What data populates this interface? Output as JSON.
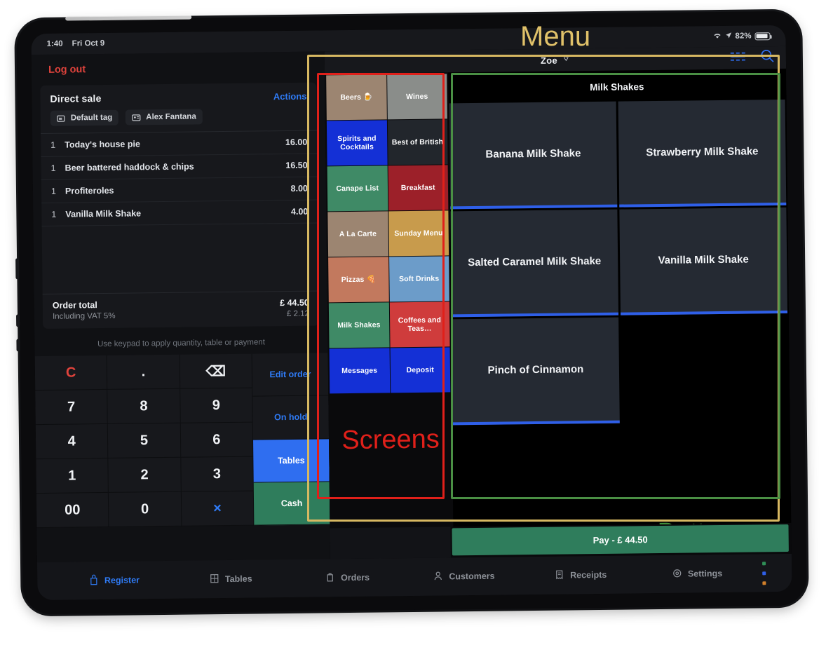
{
  "status_bar": {
    "time": "1:40",
    "date": "Fri Oct 9",
    "battery_pct": "82%",
    "wifi_icon": "wifi-icon",
    "location_icon": "location-arrow-icon"
  },
  "left_pane": {
    "logout_label": "Log out",
    "sale_title": "Direct sale",
    "actions_label": "Actions",
    "chips": [
      {
        "label": "Default tag",
        "icon": "tag-icon"
      },
      {
        "label": "Alex Fantana",
        "icon": "contact-card-icon"
      }
    ],
    "line_items": [
      {
        "qty": "1",
        "name": "Today's house pie",
        "price": "16.00"
      },
      {
        "qty": "1",
        "name": "Beer battered haddock & chips",
        "price": "16.50"
      },
      {
        "qty": "1",
        "name": "Profiteroles",
        "price": "8.00"
      },
      {
        "qty": "1",
        "name": "Vanilla Milk Shake",
        "price": "4.00"
      }
    ],
    "totals": {
      "order_total_label": "Order total",
      "order_total_value": "£ 44.50",
      "vat_label": "Including VAT 5%",
      "vat_value": "£ 2.12"
    },
    "keypad_hint": "Use keypad to apply quantity, table or payment",
    "keypad": [
      {
        "label": "C",
        "style": "red"
      },
      {
        "label": ".",
        "style": "plain"
      },
      {
        "label": "⌫",
        "style": "plain"
      },
      {
        "label": "7",
        "style": "plain"
      },
      {
        "label": "8",
        "style": "plain"
      },
      {
        "label": "9",
        "style": "plain"
      },
      {
        "label": "4",
        "style": "plain"
      },
      {
        "label": "5",
        "style": "plain"
      },
      {
        "label": "6",
        "style": "plain"
      },
      {
        "label": "1",
        "style": "plain"
      },
      {
        "label": "2",
        "style": "plain"
      },
      {
        "label": "3",
        "style": "plain"
      },
      {
        "label": "00",
        "style": "plain"
      },
      {
        "label": "0",
        "style": "plain"
      },
      {
        "label": "×",
        "style": "blue"
      }
    ],
    "side_keys": [
      {
        "label": "Edit order",
        "style": "plain"
      },
      {
        "label": "On hold",
        "style": "plain"
      },
      {
        "label": "Tables",
        "style": "tables"
      },
      {
        "label": "Cash",
        "style": "cash"
      }
    ]
  },
  "menu": {
    "header": {
      "title": "Zoe",
      "pin_icon": "pin-icon",
      "hamburger_icon": "hamburger-menu-icon",
      "search_icon": "search-icon"
    },
    "screens": [
      {
        "label": "Beers 🍺",
        "color": "#9c8571"
      },
      {
        "label": "Wines",
        "color": "#8a8d8a"
      },
      {
        "label": "Spirits and Cocktails",
        "color": "#1430d6"
      },
      {
        "label": "Best of British",
        "color": "#22262c"
      },
      {
        "label": "Canape List",
        "color": "#3f8a66"
      },
      {
        "label": "Breakfast",
        "color": "#9c2029"
      },
      {
        "label": "A La Carte",
        "color": "#9c8571"
      },
      {
        "label": "Sunday Menu",
        "color": "#c89b4c"
      },
      {
        "label": "Pizzas 🍕",
        "color": "#c2795e"
      },
      {
        "label": "Soft Drinks",
        "color": "#6c9cc9"
      },
      {
        "label": "Milk Shakes",
        "color": "#3f8a66"
      },
      {
        "label": "Coffees and Teas…",
        "color": "#cf3c3c"
      },
      {
        "label": "Messages",
        "color": "#1430d6"
      },
      {
        "label": "Deposit",
        "color": "#1430d6"
      }
    ],
    "buttons_title": "Milk Shakes",
    "buttons": [
      {
        "label": "Banana Milk Shake",
        "empty": false
      },
      {
        "label": "Strawberry Milk Shake",
        "empty": false
      },
      {
        "label": "Salted Caramel Milk Shake",
        "empty": false
      },
      {
        "label": "Vanilla Milk Shake",
        "empty": false
      },
      {
        "label": "Pinch of Cinnamon",
        "empty": false
      },
      {
        "label": "",
        "empty": true
      }
    ],
    "pay_label": "Pay - £ 44.50"
  },
  "nav": {
    "items": [
      {
        "label": "Register",
        "icon": "register-icon",
        "active": true
      },
      {
        "label": "Tables",
        "icon": "tables-icon",
        "active": false
      },
      {
        "label": "Orders",
        "icon": "orders-icon",
        "active": false
      },
      {
        "label": "Customers",
        "icon": "customers-icon",
        "active": false
      },
      {
        "label": "Receipts",
        "icon": "receipts-icon",
        "active": false
      },
      {
        "label": "Settings",
        "icon": "settings-gear-icon",
        "active": false
      }
    ],
    "dots": [
      "#2f8f57",
      "#2f5fe8",
      "#d2802a"
    ]
  },
  "annotations": {
    "menu": {
      "label": "Menu",
      "color": "#e0c169"
    },
    "screens": {
      "label": "Screens",
      "color": "#e0201a"
    },
    "buttons": {
      "label": "Buttons",
      "color": "#4a8f44"
    }
  }
}
